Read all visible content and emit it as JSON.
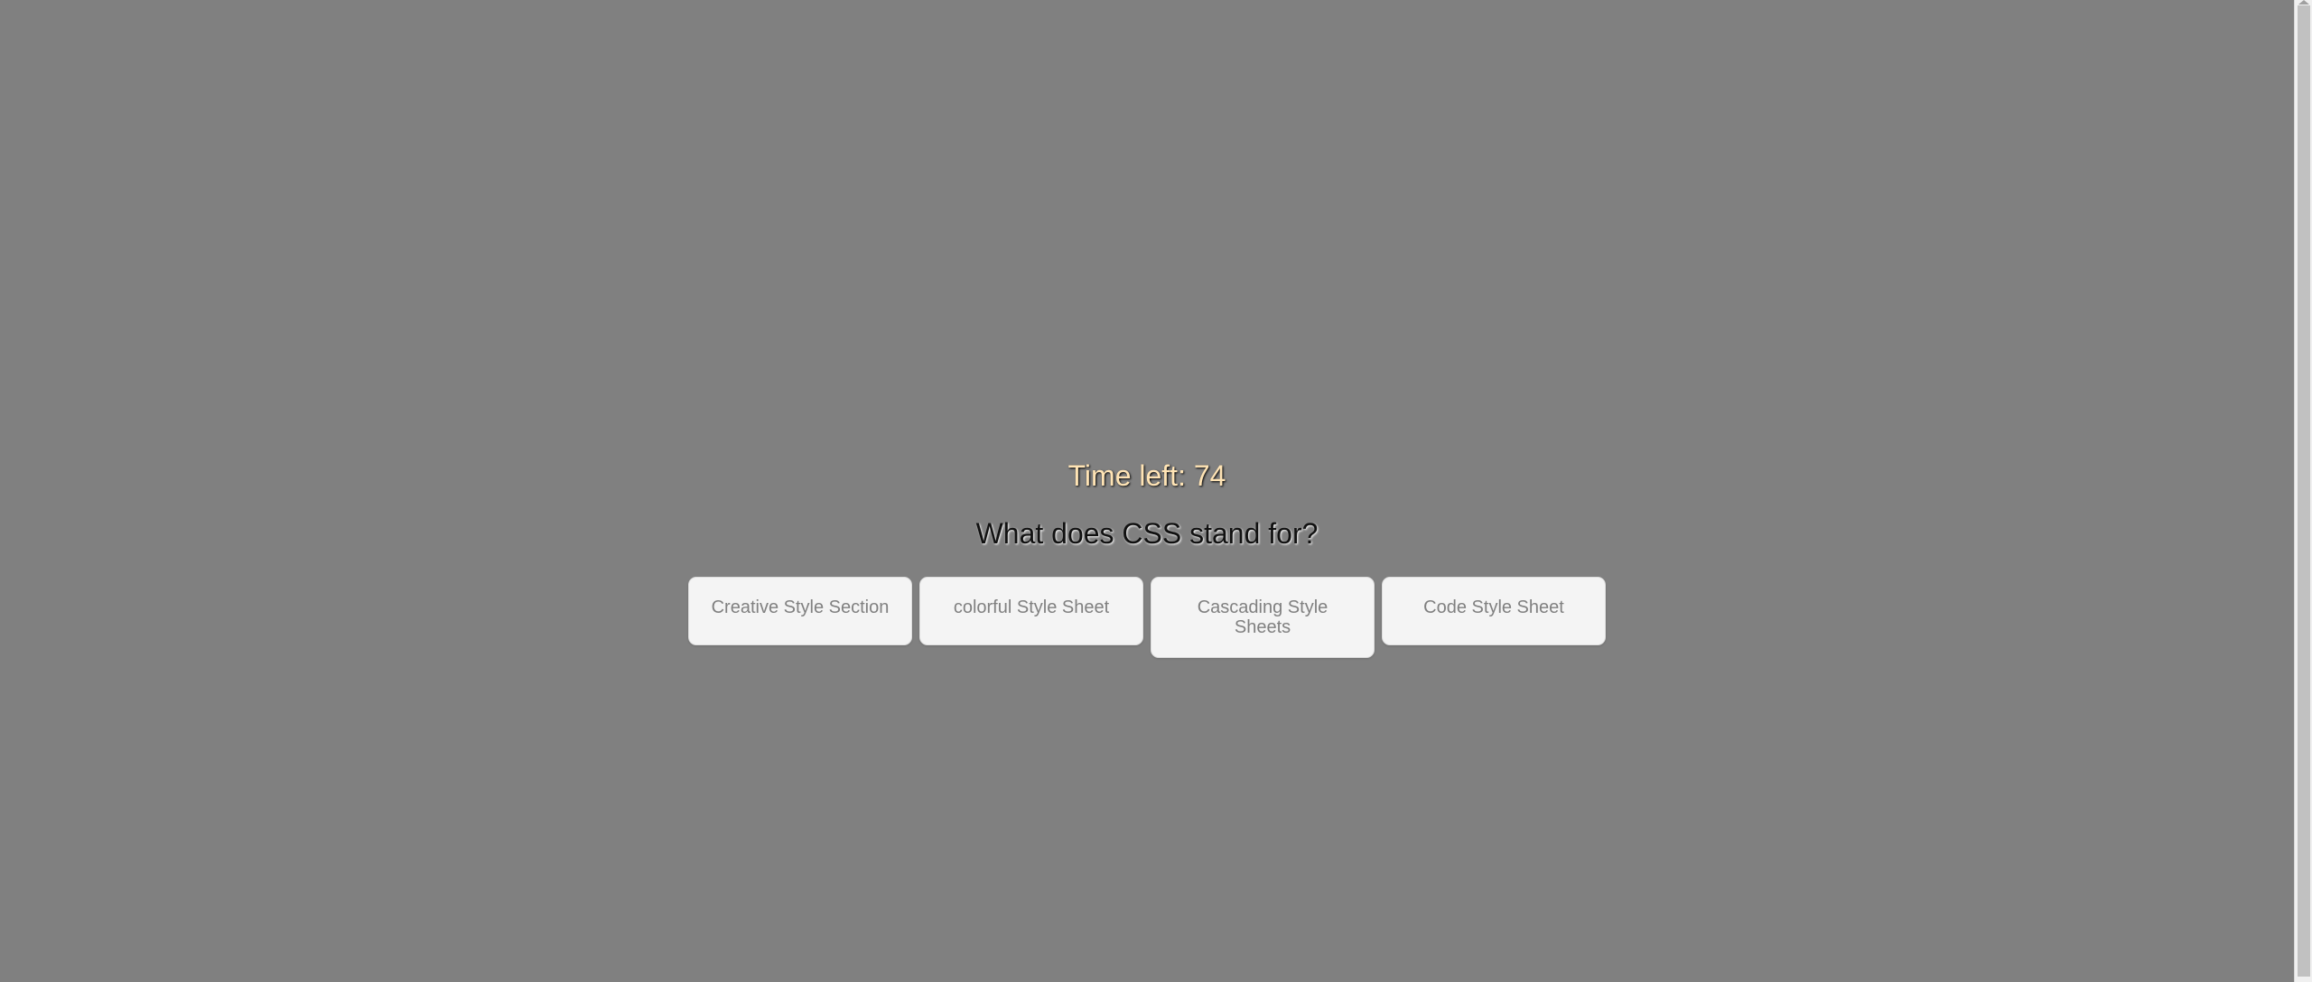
{
  "quiz": {
    "timer_text": "Time left: 74",
    "question": "What does CSS stand for?",
    "answers": [
      {
        "label": "Creative Style Section"
      },
      {
        "label": "colorful Style Sheet"
      },
      {
        "label": "Cascading Style Sheets"
      },
      {
        "label": "Code Style Sheet"
      }
    ]
  },
  "colors": {
    "background": "#808080",
    "timer": "#ffe4b5",
    "answer_bg": "#f4f4f4",
    "answer_text": "#808080"
  }
}
